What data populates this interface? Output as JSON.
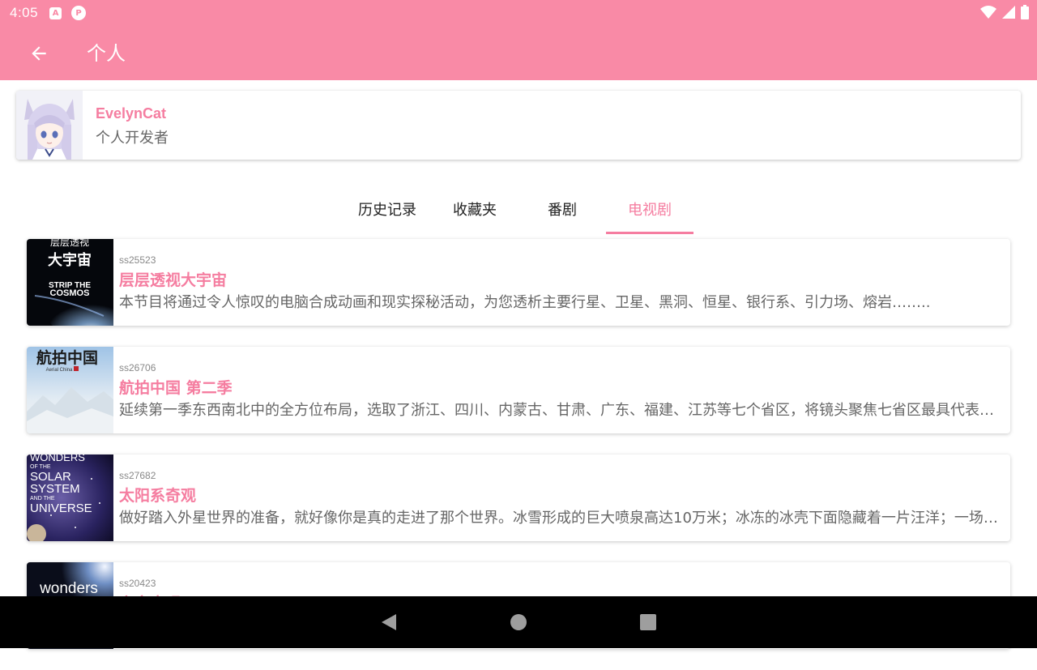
{
  "status_bar": {
    "time": "4:05",
    "icons": [
      "a-icon",
      "p-icon",
      "wifi-icon",
      "signal-icon",
      "battery-icon"
    ]
  },
  "app_bar": {
    "title": "个人",
    "back_icon": "arrow-left-icon"
  },
  "profile": {
    "name": "EvelynCat",
    "role": "个人开发者"
  },
  "tabs": [
    {
      "label": "历史记录",
      "active": false
    },
    {
      "label": "收藏夹",
      "active": false
    },
    {
      "label": "番剧",
      "active": false
    },
    {
      "label": "电视剧",
      "active": true
    }
  ],
  "items": [
    {
      "id": "ss25523",
      "title": "层层透视大宇宙",
      "desc": "本节目将通过令人惊叹的电脑合成动画和现实探秘活动，为您透析主要行星、卫星、黑洞、恒星、银行系、引力场、熔岩……..",
      "cover_text": [
        "层层透视",
        "大宇宙",
        "STRIP THE",
        "COSMOS"
      ]
    },
    {
      "id": "ss26706",
      "title": "航拍中国 第二季",
      "desc": "延续第一季东西南北中的全方位布局，选取了浙江、四川、内蒙古、甘肃、广东、福建、江苏等七个省区，将镜头聚焦七省区最具代表性的自然与人文景观",
      "cover_text": [
        "航拍中国",
        "Aerial China"
      ]
    },
    {
      "id": "ss27682",
      "title": "太阳系奇观",
      "desc": "做好踏入外星世界的准备，就好像你是真的走进了那个世界。冰雪形成的巨大喷泉高达10万米；冰冻的冰壳下面隐藏着一片汪洋；一场风暴",
      "cover_text": [
        "WONDERS",
        "OF THE",
        "SOLAR",
        "SYSTEM",
        "AND THE",
        "UNIVERSE"
      ]
    },
    {
      "id": "ss20423",
      "title": "宇宙奇观",
      "desc": "",
      "cover_text": [
        "wonders"
      ]
    }
  ],
  "colors": {
    "accent": "#f98aa6",
    "accent_text": "#f57da0",
    "nav_bar": "#000000"
  }
}
